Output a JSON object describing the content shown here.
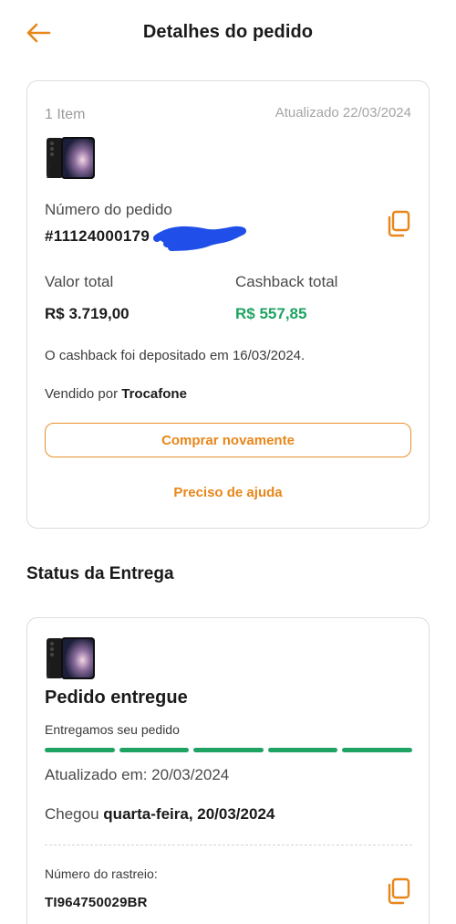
{
  "header": {
    "title": "Detalhes do pedido"
  },
  "order": {
    "items_count": "1 Item",
    "updated": "Atualizado 22/03/2024",
    "order_number_label": "Número do pedido",
    "order_number_value": "#11124000179",
    "total_label": "Valor total",
    "total_value": "R$ 3.719,00",
    "cashback_label": "Cashback total",
    "cashback_value": "R$ 557,85",
    "deposit_note": "O cashback foi depositado em 16/03/2024.",
    "seller_prefix": "Vendido por",
    "seller_name": "Trocafone",
    "buy_again_label": "Comprar novamente",
    "help_label": "Preciso de ajuda"
  },
  "delivery": {
    "section_title": "Status da Entrega",
    "status_title": "Pedido entregue",
    "status_subtitle": "Entregamos seu pedido",
    "progress_steps_completed": 5,
    "progress_steps_total": 5,
    "updated_at": "Atualizado em: 20/03/2024",
    "arrived_prefix": "Chegou",
    "arrived_date": "quarta-feira, 20/03/2024",
    "tracking_label": "Número do rastreio:",
    "tracking_value": "TI964750029BR"
  },
  "colors": {
    "accent": "#e8861a",
    "success": "#1ea362",
    "redaction": "#1f4fe8"
  },
  "icons": {
    "back": "arrow-left-icon",
    "copy": "copy-icon",
    "product": "phone-thumbnail"
  }
}
